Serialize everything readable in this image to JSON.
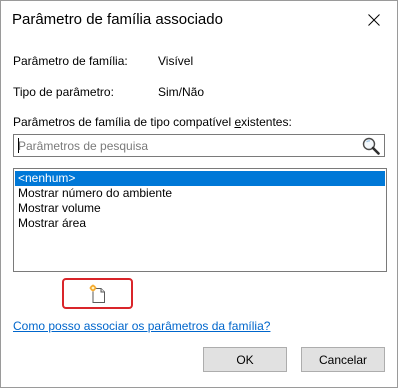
{
  "dialog": {
    "title": "Parâmetro de família associado",
    "close_icon": "close-icon"
  },
  "fields": {
    "family_parameter_label": "Parâmetro de família:",
    "family_parameter_value": "Visível",
    "parameter_type_label": "Tipo de parâmetro:",
    "parameter_type_value": "Sim/Não"
  },
  "list": {
    "label_prefix": "Parâmetros de família de tipo compatível ",
    "label_underlined": "e",
    "label_suffix": "xistentes:",
    "items": [
      {
        "label": "<nenhum>",
        "selected": true
      },
      {
        "label": "Mostrar número do ambiente",
        "selected": false
      },
      {
        "label": "Mostrar volume",
        "selected": false
      },
      {
        "label": "Mostrar área",
        "selected": false
      }
    ],
    "selection_color": "#0078d7"
  },
  "search": {
    "placeholder": "Parâmetros de pesquisa",
    "value": "",
    "icon": "magnifier-icon"
  },
  "new_parameter": {
    "icon": "new-parameter-icon",
    "highlight_color": "#d9252a"
  },
  "help": {
    "link_text": "Como posso associar os parâmetros da família?",
    "link_color": "#0066cc"
  },
  "buttons": {
    "ok_label": "OK",
    "cancel_label": "Cancelar"
  }
}
